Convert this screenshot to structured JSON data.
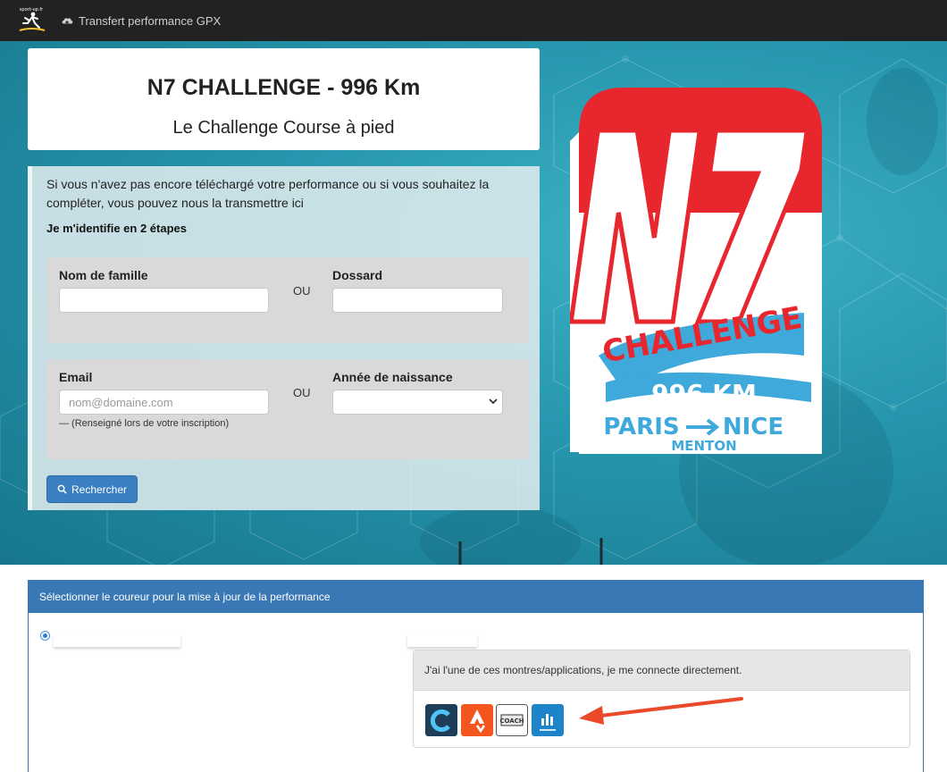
{
  "navbar": {
    "logo_icon": "runner-logo-icon",
    "link_icon": "cloud-upload-icon",
    "link_label": "Transfert performance GPX"
  },
  "hero": {
    "title": "N7 CHALLENGE - 996 Km",
    "subtitle": "Le Challenge Course à pied",
    "intro": "Si vous n'avez pas encore téléchargé votre performance ou si vous souhaitez la compléter, vous pouvez nous la transmettre ici",
    "steps_label": "Je m'identifie en 2 étapes",
    "group1": {
      "field_a_label": "Nom de famille",
      "field_a_value": "",
      "or_label": "OU",
      "field_b_label": "Dossard",
      "field_b_value": ""
    },
    "group2": {
      "email_label": "Email",
      "email_placeholder": "nom@domaine.com",
      "email_hint": "— (Renseigné lors de votre inscription)",
      "or_label": "OU",
      "year_label": "Année de naissance",
      "year_value": ""
    },
    "search_button": "Rechercher"
  },
  "logo": {
    "line1": "N7",
    "line2": "CHALLENGE",
    "distance": "996 KM",
    "route_from": "PARIS",
    "route_to": "NICE",
    "route_extra": "MENTON",
    "colors": {
      "red": "#e8262d",
      "blue": "#3fa9db",
      "white": "#ffffff"
    }
  },
  "selection": {
    "header": "Sélectionner le coureur pour la mise à jour de la performance",
    "connect_text": "J'ai l'une de ces montres/applications, je me connecte directement.",
    "apps": [
      {
        "icon": "garmin-connect-icon",
        "bg": "#1e3e58"
      },
      {
        "icon": "strava-icon",
        "bg": "#f3561e"
      },
      {
        "icon": "runmotion-coach-icon",
        "bg": "#ffffff",
        "label": "COACH"
      },
      {
        "icon": "decathlon-coach-icon",
        "bg": "#1e84c9"
      }
    ]
  }
}
